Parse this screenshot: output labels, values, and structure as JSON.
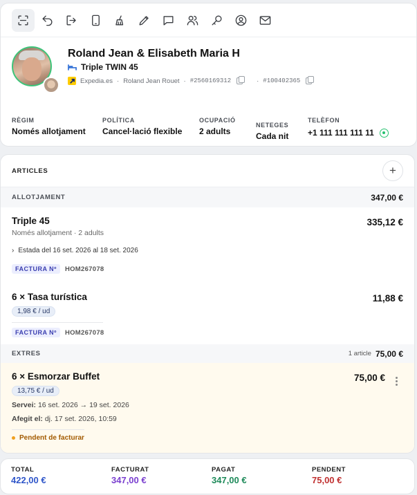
{
  "header": {
    "guest_name": "Roland Jean & Elisabeth Maria H",
    "room_type": "Triple TWIN 45",
    "channel": "Expedia.es",
    "booker": "Roland Jean Rouet",
    "booking_ref": "#2560169312",
    "internal_ref": "#100402365",
    "sep": "·"
  },
  "toolbar": {
    "icons": [
      "scan-icon",
      "undo-icon",
      "checkout-icon",
      "tablet-icon",
      "broom-icon",
      "pencil-icon",
      "chat-icon",
      "users-icon",
      "key-icon",
      "user-circle-icon",
      "mail-icon"
    ]
  },
  "info": {
    "regime_label": "RÈGIM",
    "regime_value": "Només allotjament",
    "policy_label": "POLÍTICA",
    "policy_value": "Cancel·lació flexible",
    "occupancy_label": "OCUPACIÓ",
    "occupancy_value": "2 adults",
    "cleaning_label": "NETEGES",
    "cleaning_value": "Cada nit",
    "phone_label": "TELÈFON",
    "phone_value": "+1 111 111 111 11"
  },
  "articles": {
    "title": "ARTICLES",
    "add": "+",
    "lodging": {
      "label": "ALLOTJAMENT",
      "total": "347,00 €",
      "items": [
        {
          "name": "Triple 45",
          "price": "335,12 €",
          "sub": "Només allotjament · 2 adults",
          "stay": "Estada del 16 set. 2026 al 18 set. 2026",
          "invoice_label": "FACTURA Nº",
          "invoice_num": "HOM267078"
        },
        {
          "name": "6 × Tasa turística",
          "price": "11,88 €",
          "unit": "1,98 € / ud",
          "invoice_label": "FACTURA Nº",
          "invoice_num": "HOM267078"
        }
      ]
    },
    "extras": {
      "label": "EXTRES",
      "count": "1 article",
      "total": "75,00 €",
      "item": {
        "name": "6 × Esmorzar Buffet",
        "price": "75,00 €",
        "unit": "13,75 € / ud",
        "service_label": "Servei:",
        "service_value": "16 set. 2026 → 19 set. 2026",
        "added_label": "Afegit el:",
        "added_value": "dj. 17 set. 2026, 10:59",
        "status": "Pendent de facturar"
      }
    }
  },
  "totals": {
    "total_label": "TOTAL",
    "total_value": "422,00 €",
    "invoiced_label": "FACTURAT",
    "invoiced_value": "347,00 €",
    "paid_label": "PAGAT",
    "paid_value": "347,00 €",
    "pending_label": "PENDENT",
    "pending_value": "75,00 €",
    "colors": {
      "total": "#2f56c9",
      "invoiced": "#7a3fcf",
      "paid": "#1e8a5a",
      "pending": "#c03030"
    }
  }
}
